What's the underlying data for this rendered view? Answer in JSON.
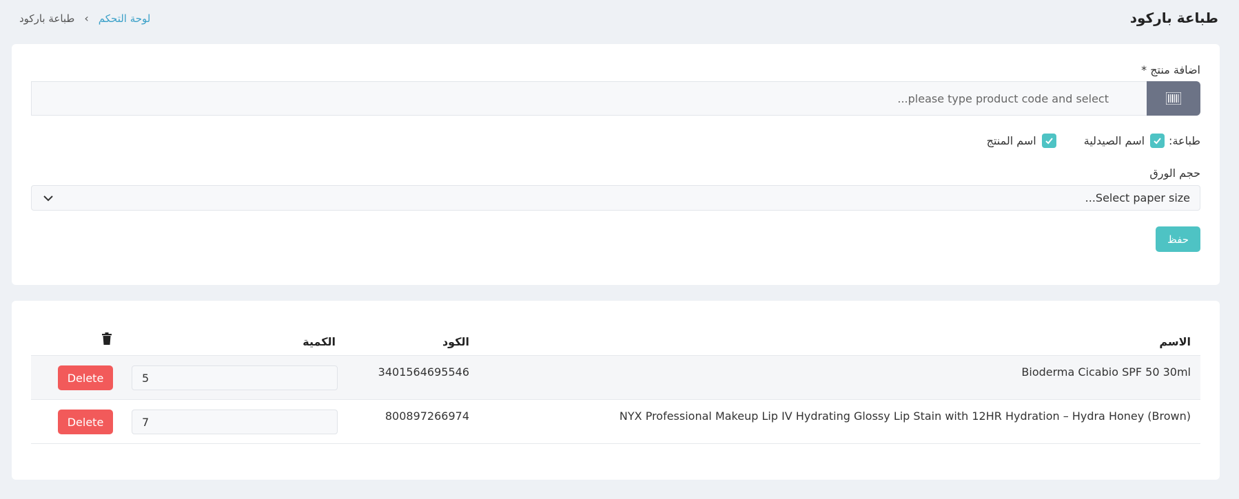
{
  "header": {
    "title": "طباعة باركود",
    "breadcrumb": {
      "home": "لوحة التحكم",
      "separator": "›",
      "current": "طباعة باركود"
    }
  },
  "form": {
    "add_product_label": "اضافة منتج *",
    "search_placeholder": "please type product code and select...",
    "search_icon": "barcode-icon",
    "print_label": "طباعة:",
    "print_options": [
      {
        "label": "اسم الصيدلية",
        "checked": true
      },
      {
        "label": "اسم المنتج",
        "checked": true
      }
    ],
    "paper_size_label": "حجم الورق",
    "paper_size_placeholder": "Select paper size...",
    "save_label": "حفظ"
  },
  "table": {
    "headers": {
      "name": "الاسم",
      "code": "الكود",
      "quantity": "الكمية"
    },
    "rows": [
      {
        "name": "Bioderma Cicabio SPF 50 30ml",
        "code": "3401564695546",
        "quantity": "5",
        "delete_label": "Delete"
      },
      {
        "name": "NYX Professional Makeup Lip IV Hydrating Glossy Lip Stain with 12HR Hydration – Hydra Honey (Brown)",
        "code": "800897266974",
        "quantity": "7",
        "delete_label": "Delete"
      }
    ]
  },
  "colors": {
    "accent": "#4ec3c4",
    "link": "#3aa0c8",
    "danger": "#f25a5a",
    "addon": "#6c7386",
    "background": "#eef1f5"
  }
}
